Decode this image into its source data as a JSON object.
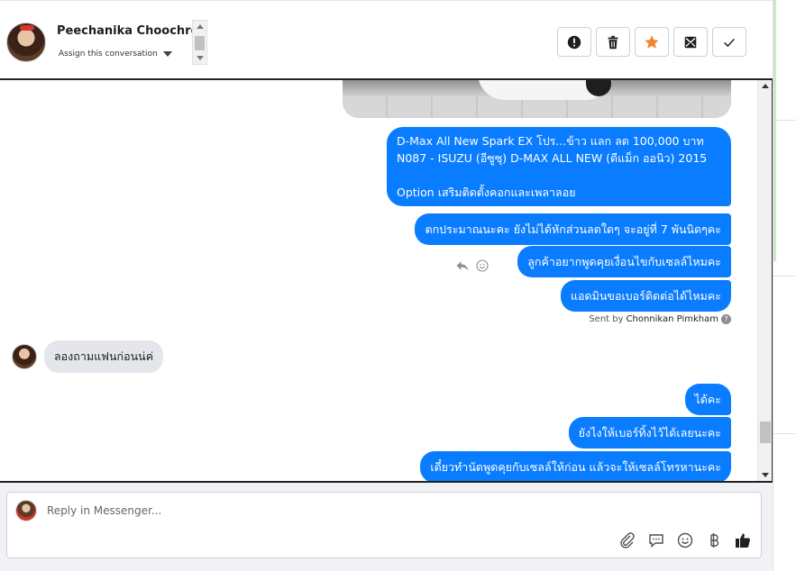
{
  "header": {
    "contact_name": "Peechanika Choochred",
    "assign_label": "Assign this conversation",
    "actions": [
      {
        "icon": "exclamation-icon",
        "label": "Mark as spam"
      },
      {
        "icon": "trash-icon",
        "label": "Delete"
      },
      {
        "icon": "star-icon",
        "label": "Star",
        "color": "#f5852c"
      },
      {
        "icon": "mark-unread-icon",
        "label": "Mark as unread"
      },
      {
        "icon": "check-icon",
        "label": "Mark as done"
      }
    ]
  },
  "messages": {
    "outgoing_1": {
      "line1": "D-Max All New Spark EX โปร...ข้าว แลก ลด 100,000 บาท",
      "line2": "N087 - ISUZU (อีซูซุ) D-MAX ALL NEW (ดีแม็ก ออนิว) 2015",
      "line3": "Option เสริมติดตั้งคอกและเพลาลอย"
    },
    "outgoing_2": "ตกประมาณนะคะ ยังไม่ได้หักส่วนลดใดๆ จะอยู่ที่ 7 พันนิดๆคะ",
    "outgoing_3": "ลูกค้าอยากพูดคุยเงื่อนไขกับเซลล์ไหมคะ",
    "outgoing_4": "แอดมินขอเบอร์ติดต่อได้ไหมคะ",
    "sent_by_prefix": "Sent by",
    "sent_by_name": "Chonnikan Pimkham",
    "incoming_1": "ลองถามแฟนก่อนน่ค่",
    "outgoing_5": "ได้คะ",
    "outgoing_6": "ยังไงให้เบอร์ทิ้งไว้ได้เลยนะคะ",
    "outgoing_7": "เดี๋ยวทำนัดพูดคุยกับเซลล์ให้ก่อน แล้วจะให้เซลล์โทรหานะคะ"
  },
  "reply": {
    "placeholder": "Reply in Messenger...",
    "tools": [
      "paperclip-icon",
      "saved-reply-icon",
      "emoji-icon",
      "baht-icon",
      "thumbs-up-icon"
    ]
  },
  "colors": {
    "outgoing_bubble": "#0a7cff",
    "incoming_bubble": "#e4e6eb",
    "star": "#f5852c"
  }
}
